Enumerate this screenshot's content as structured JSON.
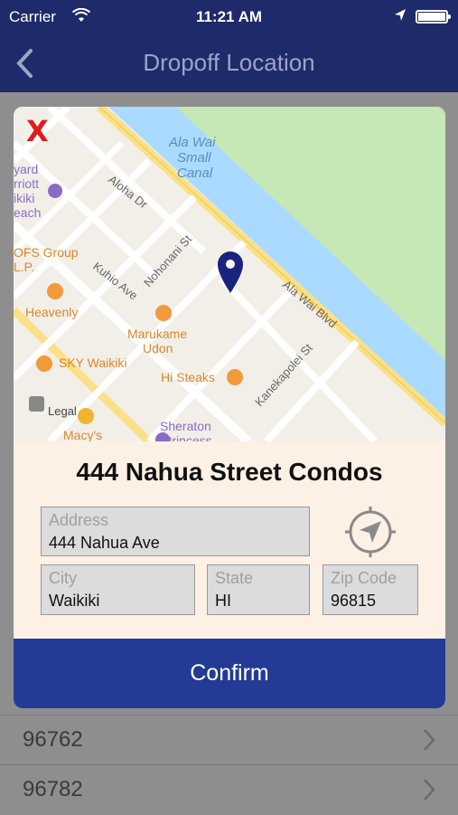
{
  "status_bar": {
    "carrier": "Carrier",
    "time": "11:21 AM"
  },
  "nav": {
    "title": "Dropoff Location",
    "back_icon": "chevron-left-icon"
  },
  "background_list": {
    "rows": [
      {
        "code": "96762"
      },
      {
        "code": "96782"
      }
    ]
  },
  "modal": {
    "close_label": "X",
    "location_name": "444 Nahua Street Condos",
    "address": {
      "label": "Address",
      "value": "444 Nahua Ave"
    },
    "city": {
      "label": "City",
      "value": "Waikiki"
    },
    "state": {
      "label": "State",
      "value": "HI"
    },
    "zip": {
      "label": "Zip Code",
      "value": "96815"
    },
    "confirm_label": "Confirm"
  },
  "map": {
    "labels": {
      "canal": [
        "Ala Wai",
        "Small",
        "Canal"
      ],
      "aloha_dr": "Aloha Dr",
      "kuhio_ave": "Kuhio Ave",
      "nohonani_st": "Nohonani St",
      "ala_wai_blvd": "Ala Wai Blvd",
      "kanekapolei_st": "Kanekapolei St",
      "yard_marriott": [
        "yard",
        "rriott",
        "ikiki",
        "each"
      ],
      "ofs_group": [
        "OFS Group",
        "L.P."
      ],
      "heavenly": "Heavenly",
      "marukame": [
        "Marukame",
        "Udon"
      ],
      "sky_waikiki": "SKY Waikiki",
      "hi_steaks": "Hi Steaks",
      "legal": "Legal",
      "macys": "Macy's",
      "sheraton": [
        "Sheraton",
        "Princess"
      ]
    },
    "colors": {
      "water": "#aadaff",
      "park": "#c6e8b4",
      "land": "#f2efe9",
      "road": "#ffffff",
      "major_road": "#fbe08a",
      "pin": "#1a237e",
      "poi": "#f29a3a"
    }
  }
}
